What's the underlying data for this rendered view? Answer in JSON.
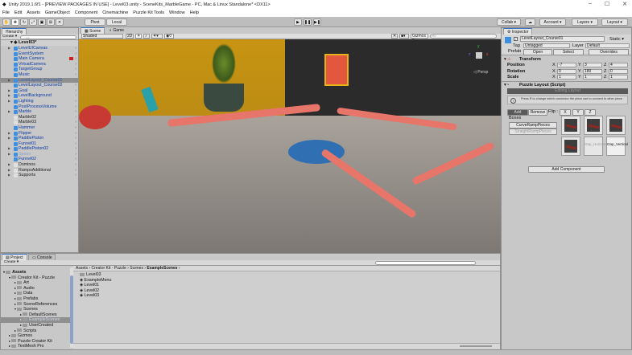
{
  "window": {
    "title": "Unity 2019.1.6f1 - [PREVIEW PACKAGES IN USE] - Level03.unity - SceneKits_MarbleGame - PC, Mac & Linux Standalone* <DX11>",
    "minimize": "–",
    "maximize": "☐",
    "close": "✕"
  },
  "menu": [
    "File",
    "Edit",
    "Assets",
    "GameObject",
    "Component",
    "Cinemachine",
    "Puzzle Kit Tools",
    "Window",
    "Help"
  ],
  "toolbar": {
    "pivot": "Pivot",
    "local": "Local",
    "collab": "Collab ▾",
    "account": "Account ▾",
    "layers": "Layers ▾",
    "layout": "Layout ▾"
  },
  "hierarchy": {
    "tab": "Hierarchy",
    "create": "Create ▾",
    "search_placeholder": "All",
    "scene": "Level03*",
    "items": [
      {
        "label": "LevelUICanvas",
        "t": "b",
        "exp": true
      },
      {
        "label": "EventSystem",
        "t": "b"
      },
      {
        "label": "Main Camera",
        "t": "b"
      },
      {
        "label": "VirtualCamera",
        "t": "b"
      },
      {
        "label": "TargetGroup",
        "t": "b"
      },
      {
        "label": "Music",
        "t": "b"
      },
      {
        "label": "LevelLayout_Course01",
        "t": "sel",
        "exp": true
      },
      {
        "label": "LevelLayout_Course02",
        "t": "b"
      },
      {
        "label": "Goal",
        "t": "b",
        "exp": true
      },
      {
        "label": "LevelBackground",
        "t": "b",
        "exp": true
      },
      {
        "label": "Lighting",
        "t": "b",
        "exp": true
      },
      {
        "label": "PostProcessVolume",
        "t": "b"
      },
      {
        "label": "Marble",
        "t": "b",
        "exp": true
      },
      {
        "label": "Marble02",
        "t": "g"
      },
      {
        "label": "Marble03",
        "t": "g"
      },
      {
        "label": "Hammer",
        "t": "b"
      },
      {
        "label": "Flipper",
        "t": "b",
        "exp": true
      },
      {
        "label": "PaddlePiston",
        "t": "b",
        "exp": true
      },
      {
        "label": "Funnel01",
        "t": "b"
      },
      {
        "label": "PaddlePiston02",
        "t": "b",
        "exp": true
      },
      {
        "label": "Spoon",
        "t": "dim",
        "exp": true
      },
      {
        "label": "Funnel02",
        "t": "b"
      },
      {
        "label": "Dominos",
        "t": "g",
        "exp": true
      },
      {
        "label": "RampsAdditional",
        "t": "g",
        "exp": true
      },
      {
        "label": "Supports",
        "t": "g",
        "exp": true
      }
    ]
  },
  "scene": {
    "tabs": [
      "Scene",
      "Game"
    ],
    "shading": "Shaded",
    "mode2d": "2D",
    "gizmos": "Gizmos ▾",
    "search_placeholder": "All",
    "persp": "◁ Persp",
    "axes": {
      "y": "y",
      "x": "x",
      "z": "z"
    }
  },
  "inspector": {
    "tab": "Inspector",
    "object_name": "LevelLayout_Course01",
    "static": "Static ▾",
    "tag_label": "Tag",
    "tag": "Untagged",
    "layer_label": "Layer",
    "layer": "Default",
    "prefab_label": "Prefab",
    "open": "Open",
    "select": "Select",
    "overrides": "Overrides",
    "transform": {
      "title": "Transform",
      "rows": [
        {
          "label": "Position",
          "x": "-7",
          "y": "3",
          "z": "4"
        },
        {
          "label": "Rotation",
          "x": "0",
          "y": "180",
          "z": "0"
        },
        {
          "label": "Scale",
          "x": "1",
          "y": "1",
          "z": "1"
        }
      ]
    },
    "puzzle": {
      "title": "Puzzle Layout (Script)",
      "editing": "Editing Layout",
      "help": "Press R to change which connector the piece use to connect to other piece",
      "add": "Add",
      "remove": "Remove",
      "flip": "Flip :",
      "flip_x": "X",
      "flip_y": "Y",
      "flip_z": "Z",
      "boxes": "Boxes",
      "curve": "CurveRampPieces",
      "straight": "StraightRampPieces",
      "gap_h": "Gap_Horizontal",
      "gap_v": "Gap_Vertical"
    },
    "add_component": "Add Component"
  },
  "project": {
    "tabs": [
      "Project",
      "Console"
    ],
    "create": "Create ▾",
    "tree": [
      {
        "label": "Assets",
        "d": 0,
        "bold": true
      },
      {
        "label": "Creator Kit - Puzzle",
        "d": 1
      },
      {
        "label": "Art",
        "d": 2
      },
      {
        "label": "Audio",
        "d": 2
      },
      {
        "label": "Data",
        "d": 2
      },
      {
        "label": "Prefabs",
        "d": 2
      },
      {
        "label": "SceneReferences",
        "d": 2
      },
      {
        "label": "Scenes",
        "d": 2
      },
      {
        "label": "DefaultScenes",
        "d": 3
      },
      {
        "label": "ExampleScenes",
        "d": 3,
        "sel": true
      },
      {
        "label": "UserCreated",
        "d": 3
      },
      {
        "label": "Scripts",
        "d": 2
      },
      {
        "label": "Gizmos",
        "d": 1
      },
      {
        "label": "Puzzle Creator Kit",
        "d": 1
      },
      {
        "label": "TextMesh Pro",
        "d": 1
      }
    ],
    "breadcrumb": [
      "Assets",
      "Creator Kit - Puzzle",
      "Scenes",
      "ExampleScenes"
    ],
    "files": [
      {
        "label": "Level03",
        "type": "folder"
      },
      {
        "label": "ExampleMenu",
        "type": "scene"
      },
      {
        "label": "Level01",
        "type": "scene"
      },
      {
        "label": "Level02",
        "type": "scene"
      },
      {
        "label": "Level03",
        "type": "scene"
      }
    ]
  }
}
